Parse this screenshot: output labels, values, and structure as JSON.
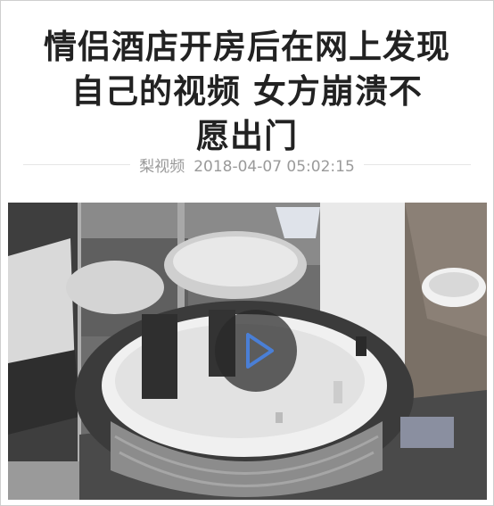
{
  "article": {
    "headline_lines": [
      "情侣酒店开房后在网上发现",
      "自己的视频 女方崩溃不",
      "愿出门"
    ],
    "source": "梨视频",
    "timestamp": "2018-04-07 05:02:15"
  },
  "video": {
    "play_icon": "play-icon",
    "play_color": "#4a7fd6"
  }
}
